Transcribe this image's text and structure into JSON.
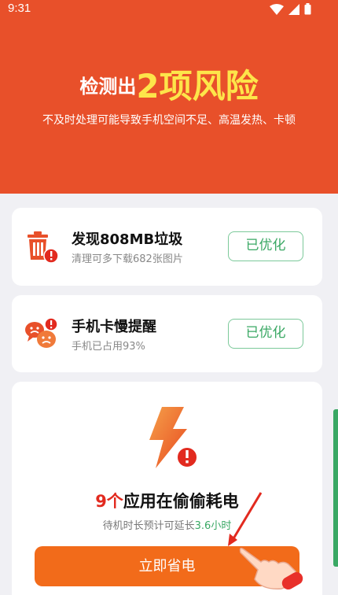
{
  "status_bar": {
    "time": "9:31"
  },
  "hero": {
    "title_prefix": "检测出",
    "title_highlight": "2项风险",
    "subtitle": "不及时处理可能导致手机空间不足、高温发热、卡顿"
  },
  "risks": [
    {
      "title": "发现808MB垃圾",
      "desc": "清理可多下载682张图片",
      "action": "已优化",
      "icon": "trash-alert-icon"
    },
    {
      "title": "手机卡慢提醒",
      "desc": "手机已占用93%",
      "action": "已优化",
      "icon": "chat-sad-alert-icon"
    }
  ],
  "battery": {
    "count": "9个",
    "title_rest": "应用在偷偷耗电",
    "sub_prefix": "待机时长预计可延长",
    "sub_value": "3.6小时",
    "button": "立即省电",
    "icon": "lightning-alert-icon"
  },
  "colors": {
    "brand": "#e8502a",
    "highlight": "#fde54a",
    "success": "#3aa864",
    "danger": "#e22a1f",
    "button": "#f26b1a"
  }
}
